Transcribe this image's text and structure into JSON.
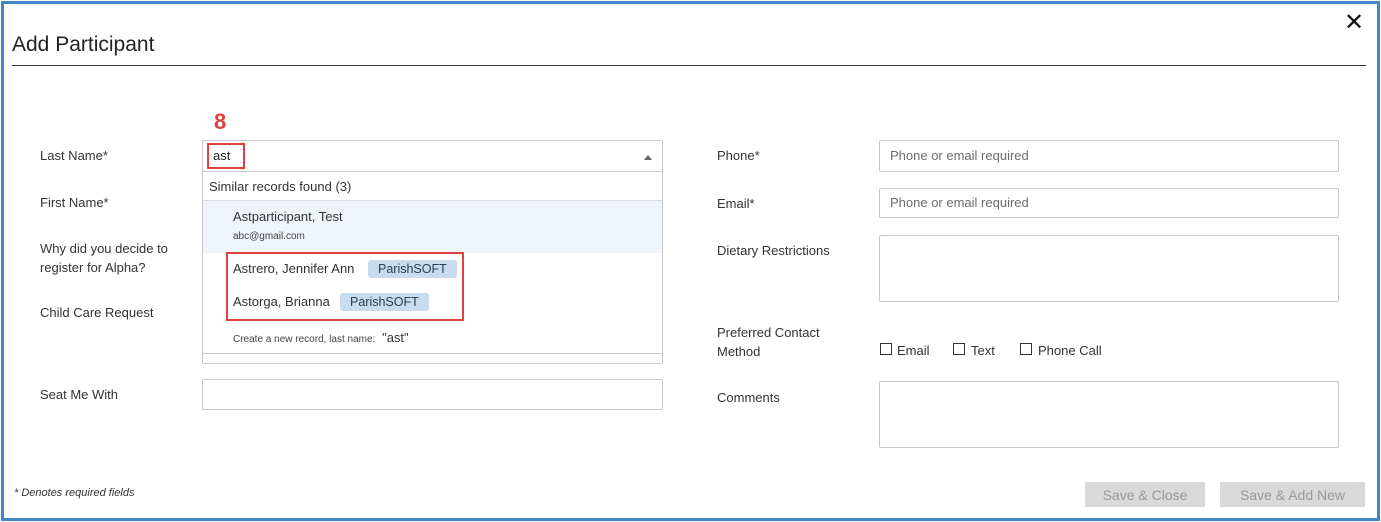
{
  "modal": {
    "title": "Add Participant",
    "close_icon": "✕"
  },
  "step_marker": "8",
  "form_left": {
    "last_name_label": "Last Name*",
    "last_name_value": "ast",
    "first_name_label": "First Name*",
    "why_label_line1": "Why did you decide to",
    "why_label_line2": "register for Alpha?",
    "child_care_label": "Child Care Request",
    "seat_me_label": "Seat Me With"
  },
  "dropdown": {
    "header": "Similar records found (3)",
    "records": [
      {
        "name": "Astparticipant, Test",
        "email": "abc@gmail.com"
      },
      {
        "name": "Astrero, Jennifer Ann",
        "badge": "ParishSOFT"
      },
      {
        "name": "Astorga, Brianna",
        "badge": "ParishSOFT"
      }
    ],
    "create_new_prefix": "Create a new record, last name:",
    "create_new_value": "\"ast\""
  },
  "form_right": {
    "phone_label": "Phone*",
    "phone_placeholder": "Phone or email required",
    "email_label": "Email*",
    "email_placeholder": "Phone or email required",
    "dietary_label": "Dietary Restrictions",
    "contact_label_line1": "Preferred Contact",
    "contact_label_line2": "Method",
    "contact_options": [
      "Email",
      "Text",
      "Phone Call"
    ],
    "comments_label": "Comments"
  },
  "footer": {
    "required_note": "* Denotes required fields",
    "save_close": "Save & Close",
    "save_add_new": "Save & Add New"
  },
  "colors": {
    "frame": "#3d88c8",
    "highlight": "#e0413f",
    "badge_bg": "#c9dcee"
  }
}
